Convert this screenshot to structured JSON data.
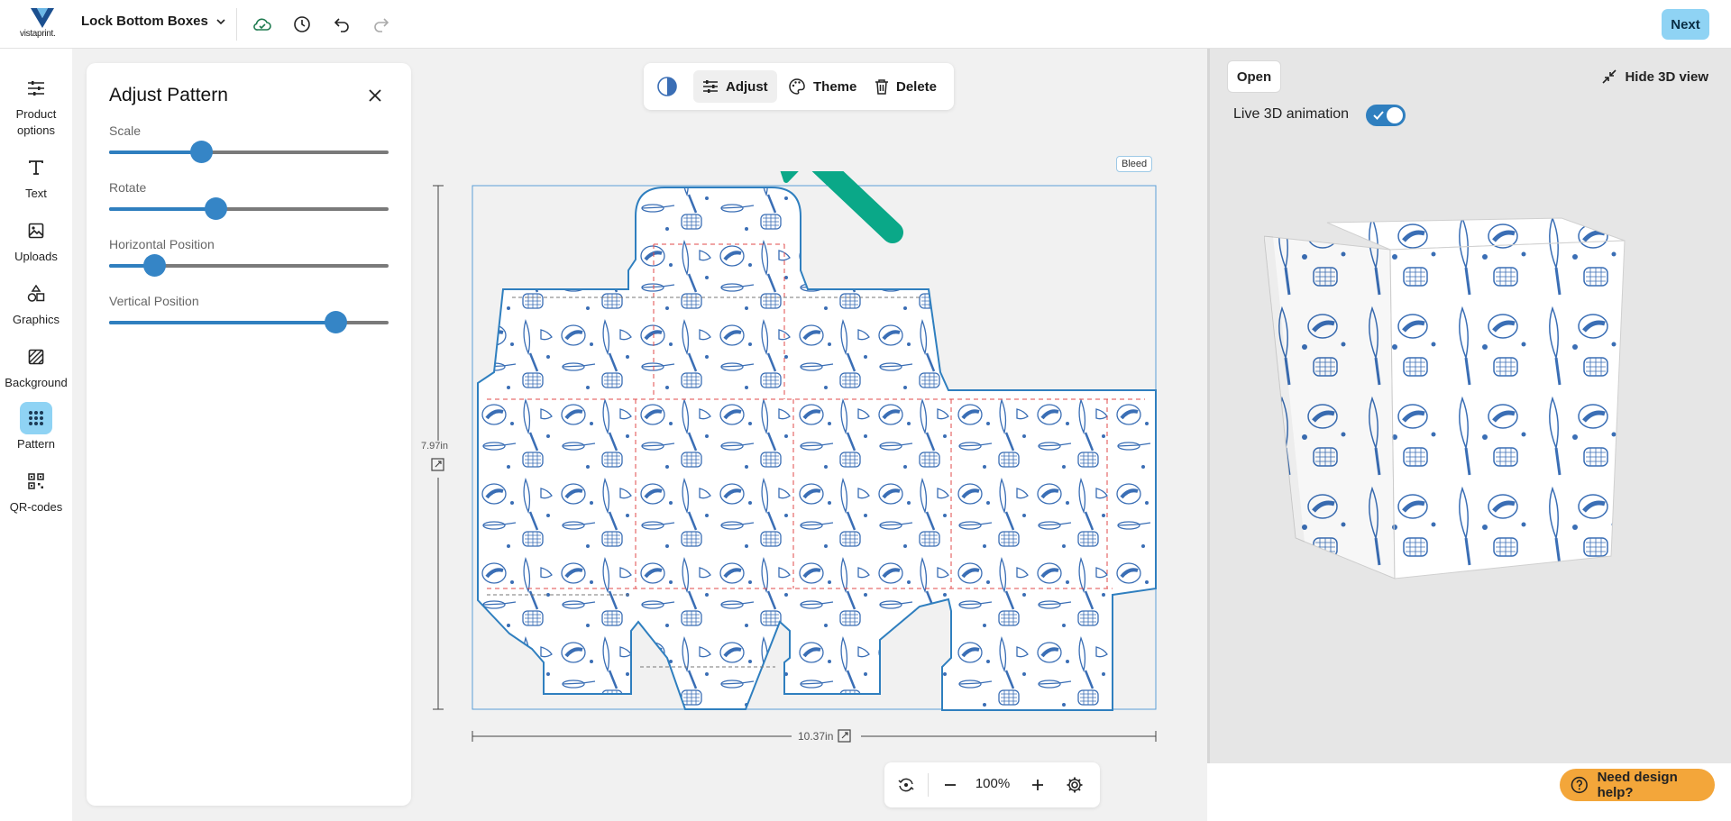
{
  "app": {
    "logo_text": "vistaprint."
  },
  "document": {
    "title": "Lock Bottom Boxes"
  },
  "topbar": {
    "next_label": "Next"
  },
  "rail": {
    "items": [
      {
        "label": "Product options",
        "icon": "sliders-icon"
      },
      {
        "label": "Text",
        "icon": "text-icon"
      },
      {
        "label": "Uploads",
        "icon": "image-icon"
      },
      {
        "label": "Graphics",
        "icon": "shapes-icon"
      },
      {
        "label": "Background",
        "icon": "hatch-icon"
      },
      {
        "label": "Pattern",
        "icon": "grid-dots-icon",
        "active": true
      },
      {
        "label": "QR-codes",
        "icon": "qr-icon"
      }
    ]
  },
  "panel": {
    "title": "Adjust Pattern",
    "sliders": [
      {
        "label": "Scale",
        "value": 0.33
      },
      {
        "label": "Rotate",
        "value": 0.38
      },
      {
        "label": "Horizontal Position",
        "value": 0.16
      },
      {
        "label": "Vertical Position",
        "value": 0.81
      }
    ]
  },
  "toolbar": {
    "adjust_label": "Adjust",
    "theme_label": "Theme",
    "delete_label": "Delete"
  },
  "canvas": {
    "bleed_label": "Bleed",
    "height_label": "7.97in",
    "width_label": "10.37in"
  },
  "zoom": {
    "value": "100%"
  },
  "preview3d": {
    "open_label": "Open",
    "hide_label": "Hide 3D view",
    "live_label": "Live 3D animation",
    "live_on": true
  },
  "help": {
    "label": "Need design help?"
  },
  "colors": {
    "accent": "#2f7fbf",
    "next_bg": "#8fd3f4",
    "help_bg": "#f3a63a",
    "arrow": "#0aa888",
    "pattern": "#3a6eb5"
  }
}
